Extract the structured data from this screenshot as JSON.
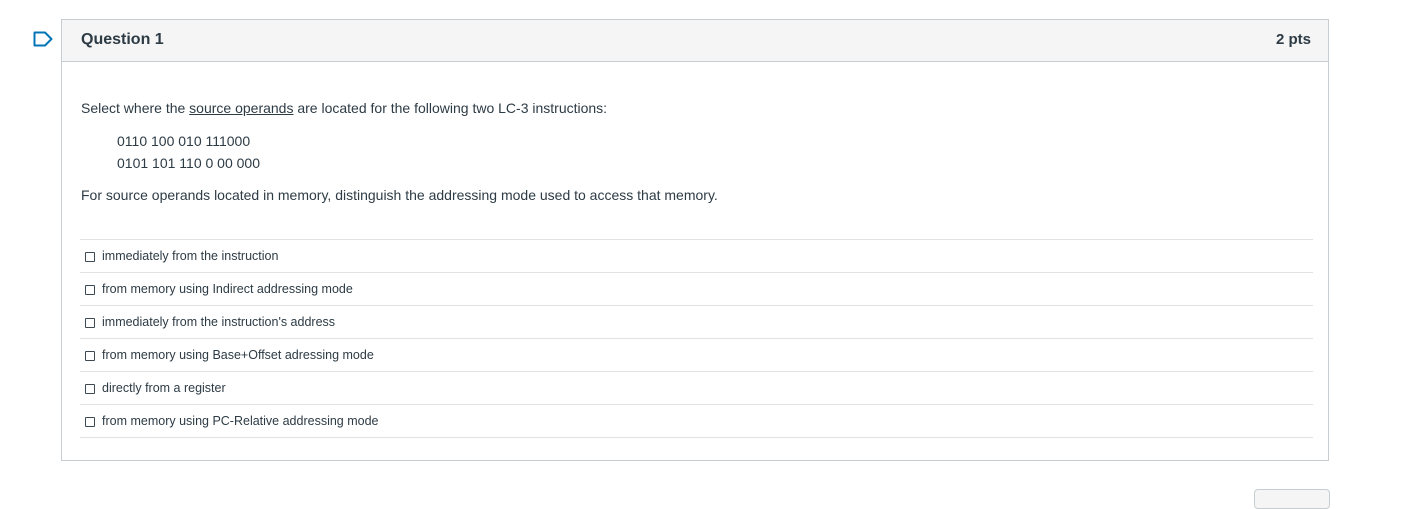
{
  "question": {
    "title": "Question 1",
    "points": "2 pts",
    "prompt_before": "Select where the ",
    "prompt_link": "source operands",
    "prompt_after": " are located for the following two LC-3 instructions:",
    "code_lines": [
      "0110 100 010 111000",
      "0101 101 110 0 00 000"
    ],
    "prompt2": "For source operands located in memory, distinguish the addressing mode used to access that memory.",
    "answers": [
      {
        "label": "immediately from the instruction",
        "checked": false
      },
      {
        "label": "from memory using Indirect addressing mode",
        "checked": false
      },
      {
        "label": "immediately from the instruction's address",
        "checked": false
      },
      {
        "label": "from memory using Base+Offset adressing mode",
        "checked": false
      },
      {
        "label": "directly from a register",
        "checked": false
      },
      {
        "label": "from memory using PC-Relative addressing mode",
        "checked": false
      }
    ]
  },
  "icons": {
    "flag": "flag-question-icon"
  },
  "colors": {
    "accent": "#0374b5",
    "text": "#2d3b45",
    "border": "#c7cdd1",
    "header_bg": "#f5f5f5"
  }
}
